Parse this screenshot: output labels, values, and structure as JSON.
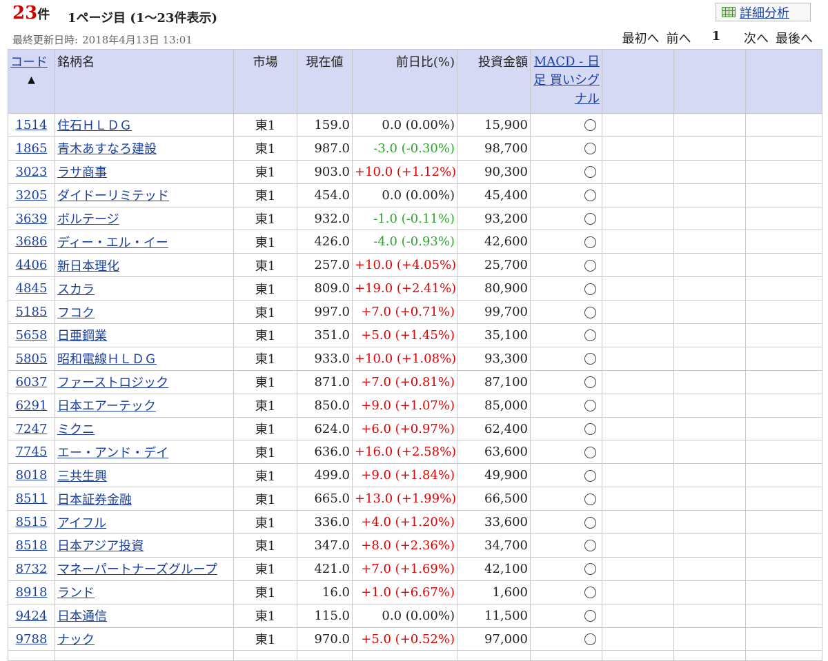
{
  "header": {
    "count_num": "23",
    "count_unit": "件",
    "page_info": "1ページ目 (1〜23件表示)",
    "updated_label": "最終更新日時:",
    "updated_value": "2018年4月13日 13:01",
    "detail_button": "詳細分析",
    "pager": {
      "first": "最初へ",
      "prev": "前へ",
      "current": "1",
      "next": "次へ",
      "last": "最後へ"
    }
  },
  "table": {
    "columns": {
      "code": "コード",
      "name": "銘柄名",
      "market": "市場",
      "price": "現在値",
      "change": "前日比(%)",
      "amount": "投資金額",
      "macd": "MACD - 日足 買いシグナル"
    },
    "sort_indicator": "▲",
    "signal_symbol": "○",
    "rows": [
      {
        "code": "1514",
        "name": "住石ＨＬＤＧ",
        "market": "東1",
        "price": "159.0",
        "change": "0.0 (0.00%)",
        "dir": "zero",
        "amount": "15,900"
      },
      {
        "code": "1865",
        "name": "青木あすなろ建設",
        "market": "東1",
        "price": "987.0",
        "change": "-3.0 (-0.30%)",
        "dir": "neg",
        "amount": "98,700"
      },
      {
        "code": "3023",
        "name": "ラサ商事",
        "market": "東1",
        "price": "903.0",
        "change": "+10.0 (+1.12%)",
        "dir": "pos",
        "amount": "90,300"
      },
      {
        "code": "3205",
        "name": "ダイドーリミテッド",
        "market": "東1",
        "price": "454.0",
        "change": "0.0 (0.00%)",
        "dir": "zero",
        "amount": "45,400"
      },
      {
        "code": "3639",
        "name": "ボルテージ",
        "market": "東1",
        "price": "932.0",
        "change": "-1.0 (-0.11%)",
        "dir": "neg",
        "amount": "93,200"
      },
      {
        "code": "3686",
        "name": "ディー・エル・イー",
        "market": "東1",
        "price": "426.0",
        "change": "-4.0 (-0.93%)",
        "dir": "neg",
        "amount": "42,600"
      },
      {
        "code": "4406",
        "name": "新日本理化",
        "market": "東1",
        "price": "257.0",
        "change": "+10.0 (+4.05%)",
        "dir": "pos",
        "amount": "25,700"
      },
      {
        "code": "4845",
        "name": "スカラ",
        "market": "東1",
        "price": "809.0",
        "change": "+19.0 (+2.41%)",
        "dir": "pos",
        "amount": "80,900"
      },
      {
        "code": "5185",
        "name": "フコク",
        "market": "東1",
        "price": "997.0",
        "change": "+7.0 (+0.71%)",
        "dir": "pos",
        "amount": "99,700"
      },
      {
        "code": "5658",
        "name": "日亜鋼業",
        "market": "東1",
        "price": "351.0",
        "change": "+5.0 (+1.45%)",
        "dir": "pos",
        "amount": "35,100"
      },
      {
        "code": "5805",
        "name": "昭和電線ＨＬＤＧ",
        "market": "東1",
        "price": "933.0",
        "change": "+10.0 (+1.08%)",
        "dir": "pos",
        "amount": "93,300"
      },
      {
        "code": "6037",
        "name": "ファーストロジック",
        "market": "東1",
        "price": "871.0",
        "change": "+7.0 (+0.81%)",
        "dir": "pos",
        "amount": "87,100"
      },
      {
        "code": "6291",
        "name": "日本エアーテック",
        "market": "東1",
        "price": "850.0",
        "change": "+9.0 (+1.07%)",
        "dir": "pos",
        "amount": "85,000"
      },
      {
        "code": "7247",
        "name": "ミクニ",
        "market": "東1",
        "price": "624.0",
        "change": "+6.0 (+0.97%)",
        "dir": "pos",
        "amount": "62,400"
      },
      {
        "code": "7745",
        "name": "エー・アンド・デイ",
        "market": "東1",
        "price": "636.0",
        "change": "+16.0 (+2.58%)",
        "dir": "pos",
        "amount": "63,600"
      },
      {
        "code": "8018",
        "name": "三共生興",
        "market": "東1",
        "price": "499.0",
        "change": "+9.0 (+1.84%)",
        "dir": "pos",
        "amount": "49,900"
      },
      {
        "code": "8511",
        "name": "日本証券金融",
        "market": "東1",
        "price": "665.0",
        "change": "+13.0 (+1.99%)",
        "dir": "pos",
        "amount": "66,500"
      },
      {
        "code": "8515",
        "name": "アイフル",
        "market": "東1",
        "price": "336.0",
        "change": "+4.0 (+1.20%)",
        "dir": "pos",
        "amount": "33,600"
      },
      {
        "code": "8518",
        "name": "日本アジア投資",
        "market": "東1",
        "price": "347.0",
        "change": "+8.0 (+2.36%)",
        "dir": "pos",
        "amount": "34,700"
      },
      {
        "code": "8732",
        "name": "マネーパートナーズグループ",
        "market": "東1",
        "price": "421.0",
        "change": "+7.0 (+1.69%)",
        "dir": "pos",
        "amount": "42,100"
      },
      {
        "code": "8918",
        "name": "ランド",
        "market": "東1",
        "price": "16.0",
        "change": "+1.0 (+6.67%)",
        "dir": "pos",
        "amount": "1,600"
      },
      {
        "code": "9424",
        "name": "日本通信",
        "market": "東1",
        "price": "115.0",
        "change": "0.0 (0.00%)",
        "dir": "zero",
        "amount": "11,500"
      },
      {
        "code": "9788",
        "name": "ナック",
        "market": "東1",
        "price": "970.0",
        "change": "+5.0 (+0.52%)",
        "dir": "pos",
        "amount": "97,000"
      }
    ]
  },
  "colors": {
    "positive": "#e00000",
    "negative": "#2ca52c",
    "header_bg": "#d6d9f3",
    "link": "#1a3fa0",
    "count": "#cc0000"
  }
}
